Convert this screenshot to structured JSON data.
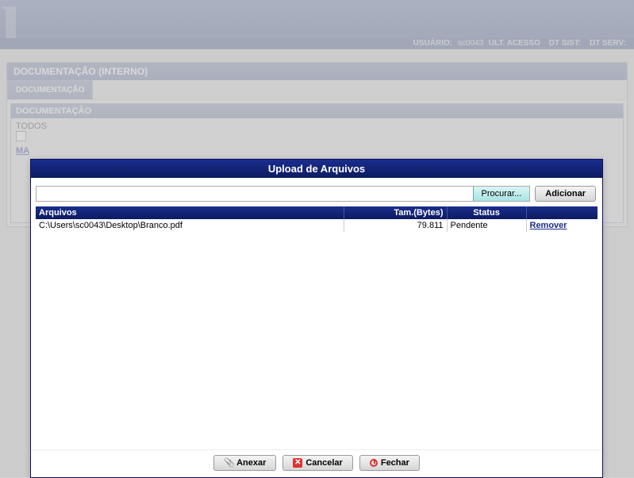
{
  "header": {
    "usuario_label": "USUÁRIO:",
    "usuario_value": "sc0043",
    "ult_acesso_label": "ULT. ACESSO",
    "ult_acesso_value": "",
    "dt_sist_label": "DT SIST:",
    "dt_sist_value": "",
    "dt_serv_label": "DT SERV:",
    "dt_serv_value": ""
  },
  "panel": {
    "title": "DOCUMENTAÇÃO (INTERNO)",
    "tab_label": "DOCUMENTAÇÃO",
    "sub_title": "DOCUMENTAÇÃO",
    "todos_label": "TODOS",
    "mais_label": "MA"
  },
  "modal": {
    "title": "Upload de Arquivos",
    "procurar_label": "Procurar...",
    "adicionar_label": "Adicionar",
    "columns": {
      "arquivos": "Arquivos",
      "tam": "Tam.(Bytes)",
      "status": "Status",
      "act": ""
    },
    "rows": [
      {
        "file": "C:\\Users\\sc0043\\Desktop\\Branco.pdf",
        "size": "79.811",
        "status": "Pendente",
        "action": "Remover"
      }
    ],
    "actions": {
      "anexar": "Anexar",
      "cancelar": "Cancelar",
      "fechar": "Fechar"
    }
  }
}
